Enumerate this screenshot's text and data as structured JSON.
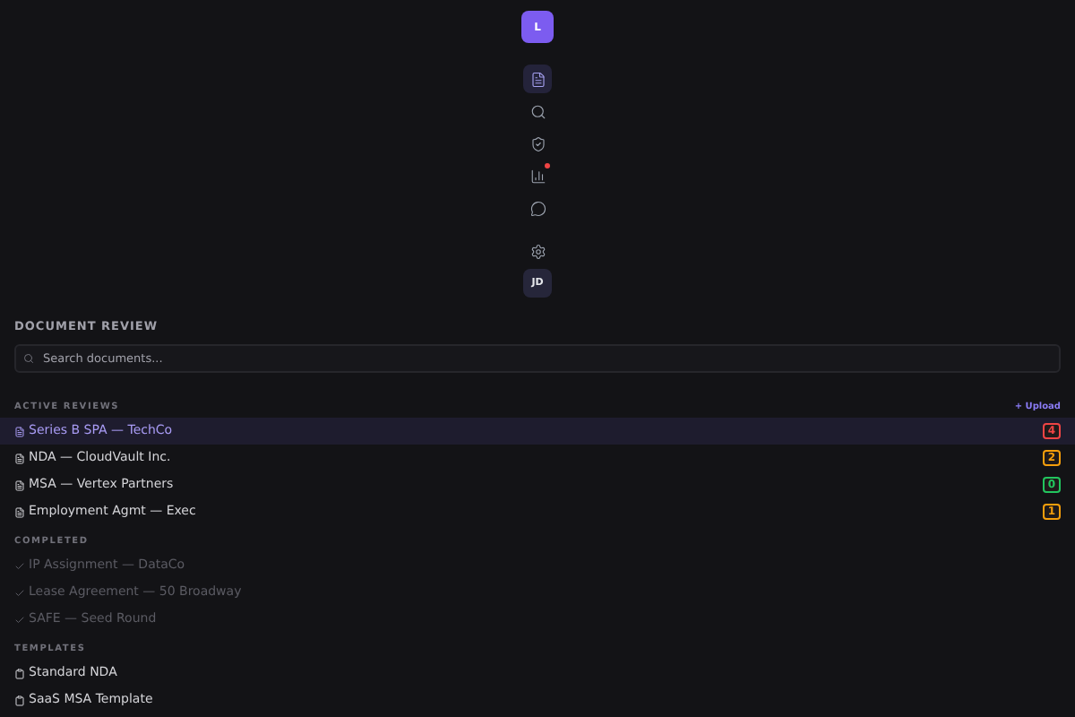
{
  "rail": {
    "logo": "L",
    "items": [
      {
        "kind": "document",
        "selected": true,
        "notify": false
      },
      {
        "kind": "search",
        "selected": false,
        "notify": false
      },
      {
        "kind": "shield",
        "selected": false,
        "notify": false
      },
      {
        "kind": "chart",
        "selected": false,
        "notify": true
      },
      {
        "kind": "chat",
        "selected": false,
        "notify": false
      }
    ],
    "settings": {
      "kind": "settings"
    },
    "avatar": "JD"
  },
  "panel": {
    "title": "DOCUMENT REVIEW",
    "search": {
      "placeholder": "Search documents..."
    },
    "sections": [
      {
        "kind": "active",
        "title": "ACTIVE REVIEWS",
        "action": "+ Upload",
        "items": [
          {
            "label": "Series B SPA — TechCo",
            "selected": true,
            "count": "4",
            "color": "#ef4444"
          },
          {
            "label": "NDA — CloudVault Inc.",
            "selected": false,
            "count": "2",
            "color": "#f59e0b"
          },
          {
            "label": "MSA — Vertex Partners",
            "selected": false,
            "count": "0",
            "color": "#22c55e"
          },
          {
            "label": "Employment Agmt — Exec",
            "selected": false,
            "count": "1",
            "color": "#f59e0b"
          }
        ]
      },
      {
        "kind": "completed",
        "title": "COMPLETED",
        "items": [
          {
            "label": "IP Assignment — DataCo",
            "selected": false
          },
          {
            "label": "Lease Agreement — 50 Broadway",
            "selected": false
          },
          {
            "label": "SAFE — Seed Round",
            "selected": false
          }
        ]
      },
      {
        "kind": "template",
        "title": "TEMPLATES",
        "items": [
          {
            "label": "Standard NDA",
            "selected": false
          },
          {
            "label": "SaaS MSA Template",
            "selected": false
          }
        ]
      }
    ]
  }
}
